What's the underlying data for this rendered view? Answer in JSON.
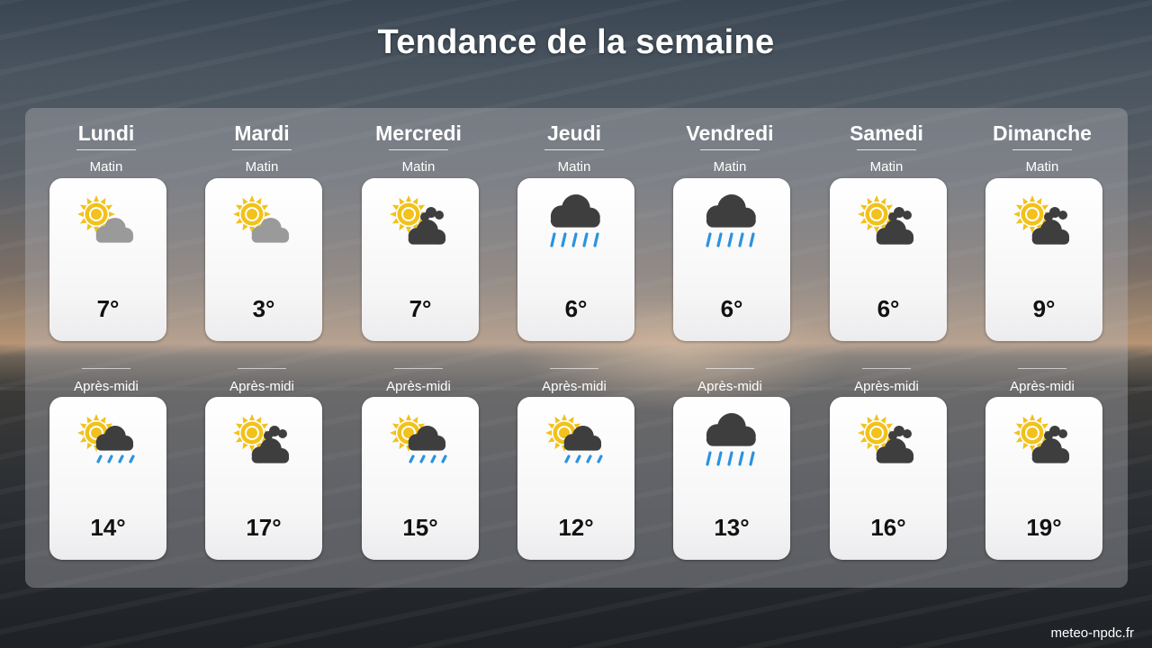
{
  "title": "Tendance de la semaine",
  "footer": "meteo-npdc.fr",
  "labels": {
    "morning": "Matin",
    "afternoon": "Après-midi"
  },
  "days": [
    {
      "name": "Lundi",
      "morning": {
        "temp": "7°",
        "icon": "sun-behind-light-cloud"
      },
      "afternoon": {
        "temp": "14°",
        "icon": "sun-cloud-light-rain"
      }
    },
    {
      "name": "Mardi",
      "morning": {
        "temp": "3°",
        "icon": "sun-behind-light-cloud"
      },
      "afternoon": {
        "temp": "17°",
        "icon": "sun-behind-dark-cloud"
      }
    },
    {
      "name": "Mercredi",
      "morning": {
        "temp": "7°",
        "icon": "sun-behind-dark-cloud"
      },
      "afternoon": {
        "temp": "15°",
        "icon": "sun-cloud-light-rain"
      }
    },
    {
      "name": "Jeudi",
      "morning": {
        "temp": "6°",
        "icon": "rain-cloud"
      },
      "afternoon": {
        "temp": "12°",
        "icon": "sun-cloud-light-rain"
      }
    },
    {
      "name": "Vendredi",
      "morning": {
        "temp": "6°",
        "icon": "rain-cloud"
      },
      "afternoon": {
        "temp": "13°",
        "icon": "rain-cloud"
      }
    },
    {
      "name": "Samedi",
      "morning": {
        "temp": "6°",
        "icon": "sun-behind-dark-cloud"
      },
      "afternoon": {
        "temp": "16°",
        "icon": "sun-behind-dark-cloud"
      }
    },
    {
      "name": "Dimanche",
      "morning": {
        "temp": "9°",
        "icon": "sun-behind-dark-cloud"
      },
      "afternoon": {
        "temp": "19°",
        "icon": "sun-behind-dark-cloud"
      }
    }
  ],
  "colors": {
    "sun": "#f2c21b",
    "cloud_light": "#9a9a9a",
    "cloud_dark": "#3e3e3e",
    "rain": "#2a93e0"
  }
}
